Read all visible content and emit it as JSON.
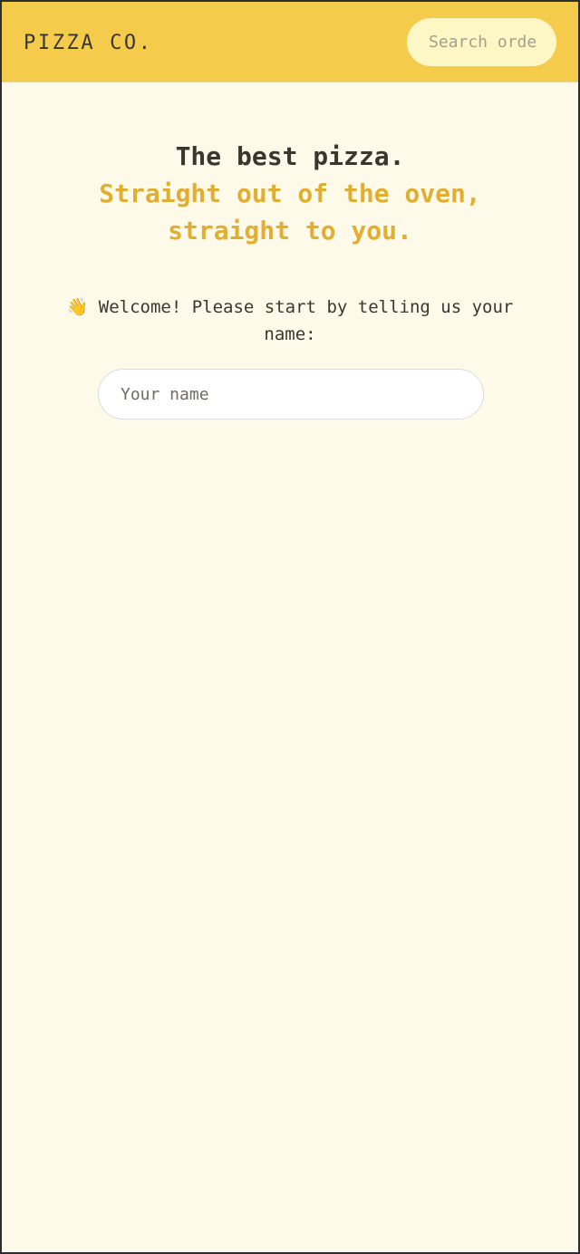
{
  "header": {
    "logo": "PIZZA CO.",
    "search_placeholder": "Search order #"
  },
  "hero": {
    "line1": "The best pizza.",
    "line2": "Straight out of the oven, straight to you."
  },
  "welcome": {
    "emoji": "👋",
    "text": "Welcome! Please start by telling us your name:"
  },
  "name_input": {
    "placeholder": "Your name",
    "value": ""
  },
  "colors": {
    "header_bg": "#f5cb4b",
    "page_bg": "#fefae9",
    "accent": "#e1ae32",
    "text": "#3a3731",
    "search_bg": "#fdf7c6"
  }
}
